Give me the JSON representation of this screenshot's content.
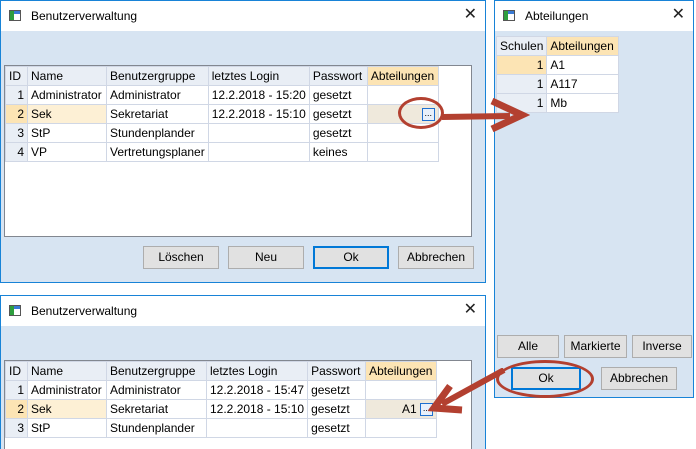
{
  "colors": {
    "accent": "#1883d7",
    "annotation": "#b34030",
    "selected_header": "#fce4b4"
  },
  "dialog_top": {
    "title": "Benutzerverwaltung",
    "close_icon": "close-icon",
    "columns": [
      "ID",
      "Name",
      "Benutzergruppe",
      "letztes Login",
      "Passwort",
      "Abteilungen"
    ],
    "rows": [
      {
        "id": "1",
        "name": "Administrator",
        "group": "Administrator",
        "login": "12.2.2018 - 15:20",
        "password": "gesetzt",
        "dept": ""
      },
      {
        "id": "2",
        "name": "Sek",
        "group": "Sekretariat",
        "login": "12.2.2018 - 15:10",
        "password": "gesetzt",
        "dept": ""
      },
      {
        "id": "3",
        "name": "StP",
        "group": "Stundenplander",
        "login": "",
        "password": "gesetzt",
        "dept": ""
      },
      {
        "id": "4",
        "name": "VP",
        "group": "Vertretungsplaner",
        "login": "",
        "password": "keines",
        "dept": ""
      }
    ],
    "ellipsis": "...",
    "buttons": {
      "delete": "Löschen",
      "new": "Neu",
      "ok": "Ok",
      "cancel": "Abbrechen"
    }
  },
  "dialog_bottom": {
    "title": "Benutzerverwaltung",
    "columns": [
      "ID",
      "Name",
      "Benutzergruppe",
      "letztes Login",
      "Passwort",
      "Abteilungen"
    ],
    "rows": [
      {
        "id": "1",
        "name": "Administrator",
        "group": "Administrator",
        "login": "12.2.2018 - 15:47",
        "password": "gesetzt",
        "dept": ""
      },
      {
        "id": "2",
        "name": "Sek",
        "group": "Sekretariat",
        "login": "12.2.2018 - 15:10",
        "password": "gesetzt",
        "dept": "A1"
      },
      {
        "id": "3",
        "name": "StP",
        "group": "Stundenplander",
        "login": "",
        "password": "gesetzt",
        "dept": ""
      }
    ],
    "ellipsis": "..."
  },
  "dialog_abteilungen": {
    "title": "Abteilungen",
    "columns": [
      "Schulen",
      "Abteilungen"
    ],
    "rows": [
      {
        "schulen": "1",
        "abteilung": "A1"
      },
      {
        "schulen": "1",
        "abteilung": "A117"
      },
      {
        "schulen": "1",
        "abteilung": "Mb"
      }
    ],
    "buttons": {
      "all": "Alle",
      "marked": "Markierte",
      "inverse": "Inverse",
      "ok": "Ok",
      "cancel": "Abbrechen"
    }
  }
}
